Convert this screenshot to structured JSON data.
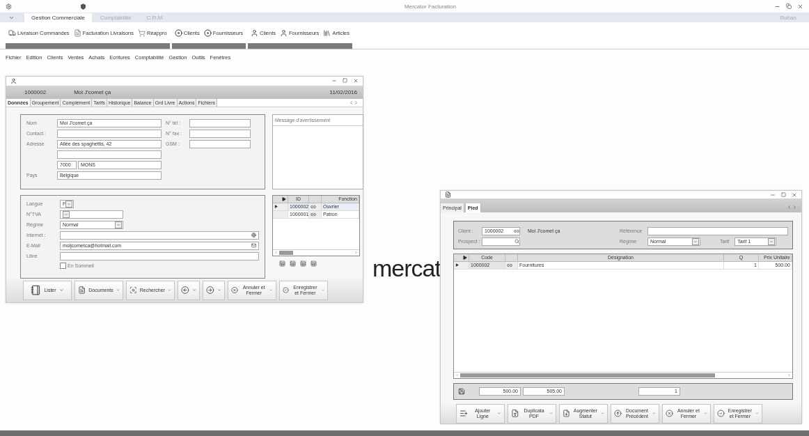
{
  "window": {
    "title": "Mercator Facturation",
    "ribbon_toggle": "Ruban"
  },
  "ribbon_tabs": [
    {
      "label": "Gestion Commerciale",
      "selected": true
    },
    {
      "label": "Comptabilité",
      "selected": false
    },
    {
      "label": "C.R.M.",
      "selected": false
    }
  ],
  "ribbon_groups": [
    {
      "items": [
        {
          "label": "Livraison Commandes",
          "kind": "delivery"
        },
        {
          "label": "Facturation Livraisons",
          "kind": "invoice"
        },
        {
          "label": "Réappro",
          "kind": "cart"
        }
      ]
    },
    {
      "items": [
        {
          "label": "Clients",
          "kind": "history"
        },
        {
          "label": "Fournisseurs",
          "kind": "history"
        }
      ]
    },
    {
      "items": [
        {
          "label": "Clients",
          "kind": "person"
        },
        {
          "label": "Fournisseurs",
          "kind": "person"
        },
        {
          "label": "Articles",
          "kind": "books"
        }
      ]
    }
  ],
  "menu": [
    "Fichier",
    "Edition",
    "Clients",
    "Ventes",
    "Achats",
    "Ecritures",
    "Comptabilité",
    "Gestion",
    "Outils",
    "Fenêtres"
  ],
  "client_window": {
    "id": "1000002",
    "name": "Moi J'comet ça",
    "date": "11/02/2016",
    "tabs": [
      {
        "label": "Données",
        "selected": true
      },
      {
        "label": "Groupement",
        "selected": false
      },
      {
        "label": "Complément",
        "selected": false
      },
      {
        "label": "Tarifs",
        "selected": false
      },
      {
        "label": "Historique",
        "selected": false
      },
      {
        "label": "Balance",
        "selected": false
      },
      {
        "label": "Grd Livre",
        "selected": false
      },
      {
        "label": "Actions",
        "selected": false
      },
      {
        "label": "Fichiers",
        "selected": false
      }
    ],
    "address": [
      {
        "kind": "field",
        "label": "Nom",
        "value": "Moi J'comet ça"
      },
      {
        "kind": "field",
        "label": "Contact :"
      },
      {
        "kind": "field",
        "label": "Adresse",
        "value": "Allée des spaghettis, 42"
      },
      {
        "kind": "field"
      },
      {
        "kind": "city",
        "postcode": "7000",
        "city": "MONS"
      },
      {
        "kind": "field",
        "label": "Pays",
        "value": "Belgique"
      }
    ],
    "phones": [
      {
        "label": "N° tél :"
      },
      {
        "label": "N° fax :"
      },
      {
        "label": "GSM :"
      }
    ],
    "message_title": "Message d'avertissement",
    "details": [
      {
        "kind": "short-select",
        "label": "Langue",
        "value": "F"
      },
      {
        "kind": "select",
        "label": "N°TVA"
      },
      {
        "kind": "select",
        "label": "Régime",
        "value": "Normal"
      },
      {
        "kind": "web",
        "label": "Internet :"
      },
      {
        "kind": "email",
        "label": "E-Mail",
        "value": "moijcometca@hotmail.com"
      },
      {
        "kind": "text",
        "label": "Libre"
      }
    ],
    "dormant": {
      "label": "En Sommeil",
      "checked": false
    },
    "contacts": {
      "columns": [
        "ID",
        "Fonction"
      ],
      "rows": [
        {
          "id": "1000002",
          "function": "Ouvrier",
          "selected": true
        },
        {
          "id": "1000001",
          "function": "Patron",
          "selected": false
        }
      ]
    },
    "buttons": [
      {
        "kind": "list",
        "label": "Lister"
      },
      {
        "kind": "documents",
        "label": "Documents"
      },
      {
        "kind": "search",
        "label": "Rechercher"
      },
      {
        "kind": "previous"
      },
      {
        "kind": "next"
      },
      {
        "kind": "cancel",
        "label": "Annuler et Fermer"
      },
      {
        "kind": "save",
        "label": "Enregistrer et Fermer"
      }
    ]
  },
  "logo": "mercat",
  "document_window": {
    "tabs": [
      {
        "label": "Principal",
        "selected": false
      },
      {
        "label": "Pied",
        "selected": true
      }
    ],
    "client_label": "Client :",
    "client_id": "1000002",
    "client_name": "Moi J'comet ça",
    "prospect_label": "Prospect :",
    "reference_label": "Référence",
    "regime_label": "Régime",
    "regime": "Normal",
    "tarif_label": "Tarif",
    "tarif": "Tarif 1",
    "lines": {
      "columns": [
        "Code",
        "Désignation",
        "Q",
        "Prix Unitaire"
      ],
      "rows": [
        {
          "code": "1000002",
          "designation": "Fournitures",
          "q": "1",
          "price": "500.00",
          "selected": true
        }
      ]
    },
    "totals": [
      "500.00",
      "505.00",
      "1"
    ],
    "buttons": [
      {
        "kind": "add-line",
        "label": "Ajouter Ligne"
      },
      {
        "kind": "pdf",
        "label": "Duplicata PDF"
      },
      {
        "kind": "status",
        "label": "Augmenter Statut"
      },
      {
        "kind": "previous-doc",
        "label": "Document Précédent"
      },
      {
        "kind": "cancel",
        "label": "Annuler et Fermer"
      },
      {
        "kind": "save",
        "label": "Enregistrer et Fermer"
      }
    ]
  }
}
